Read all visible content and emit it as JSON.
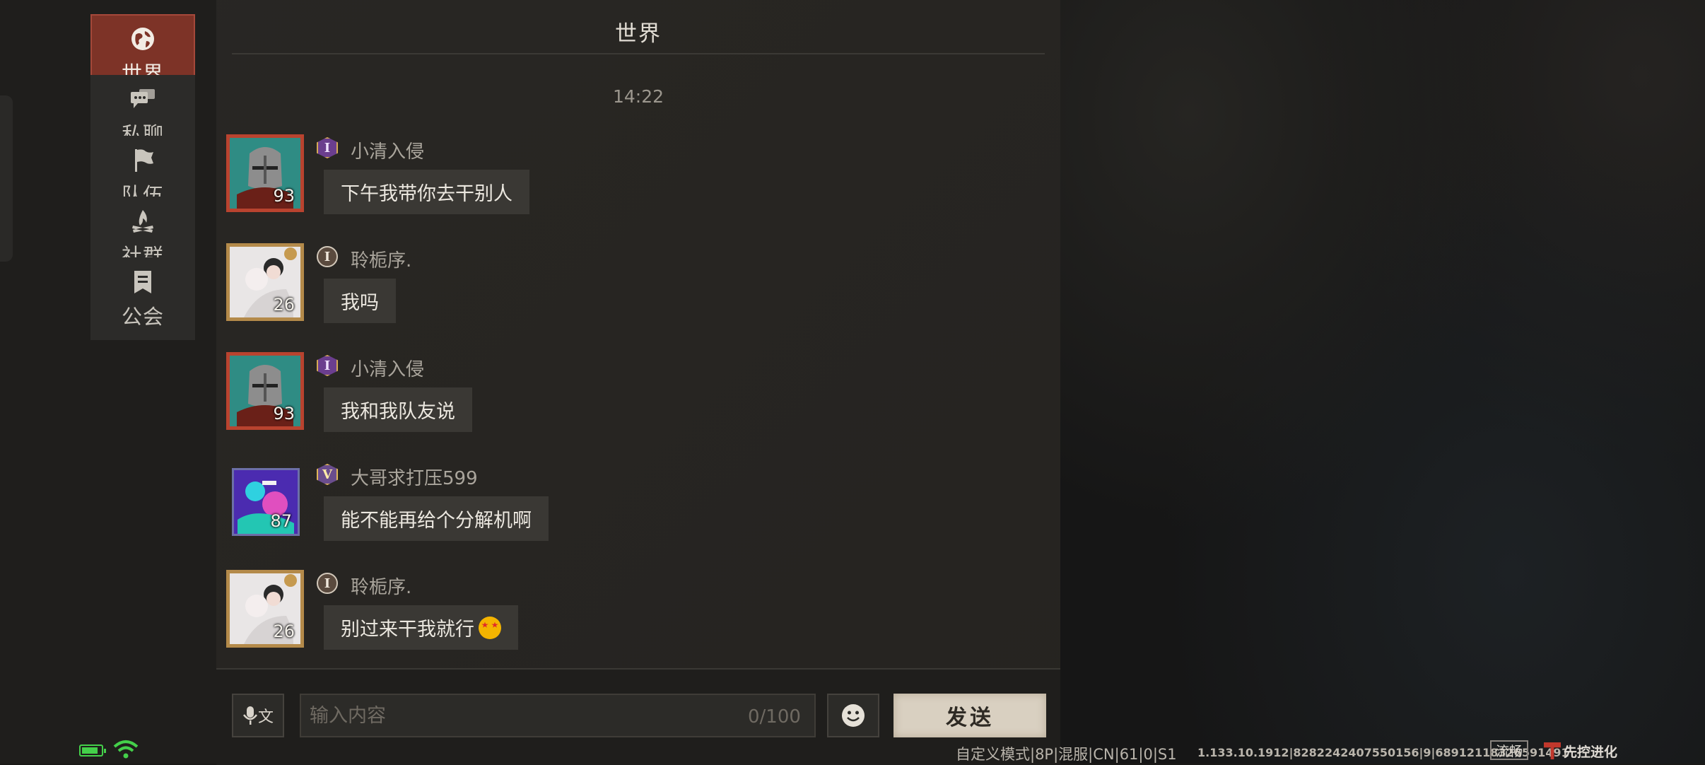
{
  "sidebar": {
    "tabs": [
      {
        "label": "世界",
        "icon": "globe-icon",
        "active": true
      },
      {
        "label": "私聊",
        "icon": "chat-bubbles-icon",
        "active": false
      },
      {
        "label": "队伍",
        "icon": "flag-icon",
        "active": false
      },
      {
        "label": "社群",
        "icon": "campfire-icon",
        "active": false
      },
      {
        "label": "公会",
        "icon": "guild-banner-icon",
        "active": false
      }
    ]
  },
  "chat": {
    "title": "世界",
    "timestamp": "14:22",
    "messages": [
      {
        "sender": "小清入侵",
        "text": "下午我带你去干别人",
        "level": "93",
        "badge": "I",
        "avatar": "knight-helmet-avatar"
      },
      {
        "sender": "聆栀序.",
        "text": "我吗",
        "level": "26",
        "badge": "I",
        "avatar": "couple-photo-avatar"
      },
      {
        "sender": "小清入侵",
        "text": "我和我队友说",
        "level": "93",
        "badge": "I",
        "avatar": "knight-helmet-avatar"
      },
      {
        "sender": "大哥求打压599",
        "text": "能不能再给个分解机啊",
        "level": "87",
        "badge": "V",
        "avatar": "purple-art-avatar"
      },
      {
        "sender": "聆栀序.",
        "text": "别过来干我就行",
        "level": "26",
        "badge": "I",
        "avatar": "couple-photo-avatar",
        "emoji": "star-struck-emoji"
      }
    ]
  },
  "input": {
    "voice_label": "文",
    "placeholder": "输入内容",
    "value": "",
    "counter": "0/100",
    "send_label": "发送"
  },
  "status": {
    "mode_info": "自定义模式|8P|混服|CN|61|0|S1",
    "build_info": "1.133.10.1912|8282242407550156|9|68912118326591491",
    "fluency": "流畅",
    "logo_text": "先控进化"
  },
  "colors": {
    "active_tab": "#7d3327",
    "battery": "#44d04a",
    "send_button": "#d9d0c1"
  }
}
